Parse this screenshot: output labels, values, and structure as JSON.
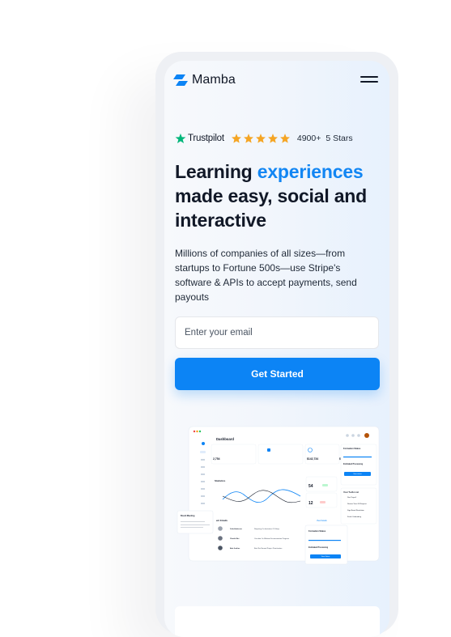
{
  "brand": {
    "name": "Mamba",
    "logo_icon": "mamba-logo-icon",
    "menu_icon": "hamburger-menu-icon"
  },
  "rating": {
    "provider": "Trustpilot",
    "stars": 5,
    "count": "4900+",
    "label": "5 Stars",
    "star_color": "#f5a524",
    "brand_star_color": "#00b67a"
  },
  "hero": {
    "title_part1": "Learning",
    "title_accent": "experiences",
    "title_part2": "made easy, social and interactive",
    "description": "Millions of companies of all sizes—from startups to Fortune 500s—use Stripe's software & APIs to accept payments, send payouts",
    "accent_color": "#1286f3"
  },
  "form": {
    "email_placeholder": "Enter your email",
    "button_label": "Get Started",
    "button_color": "#0c84f5"
  },
  "dashboard_preview": {
    "title": "Dashboard",
    "stats": [
      "2,754",
      "$142,734",
      "$5,451.56"
    ],
    "chart_title": "Statistics",
    "kpi_primary": "54",
    "kpi_secondary": "12",
    "side_title": "Formation Status",
    "side_subtitle": "Estimated Processing",
    "side_button": "View status",
    "todo_title": "Your To-Do List",
    "todo_items": [
      "Run Payroll",
      "Review Time Off Request",
      "Sign Board Resolution",
      "Finish Onboarding"
    ],
    "table_title": "ent Emails",
    "table_link": "View Details",
    "table_rows": [
      [
        "Julia Anderson",
        "Requiring Orchestration Of Urbep"
      ],
      [
        "Charlie Wei",
        "Circulate On Website Documentation Progress"
      ],
      [
        "Ada Jenkins",
        "Brief For Nomad Project Prioritization"
      ]
    ],
    "float_card": {
      "title": "Formation Status",
      "subtitle": "Estimated Processing",
      "button": "View Status"
    },
    "meeting_card": {
      "title": "Board Meeting"
    }
  }
}
